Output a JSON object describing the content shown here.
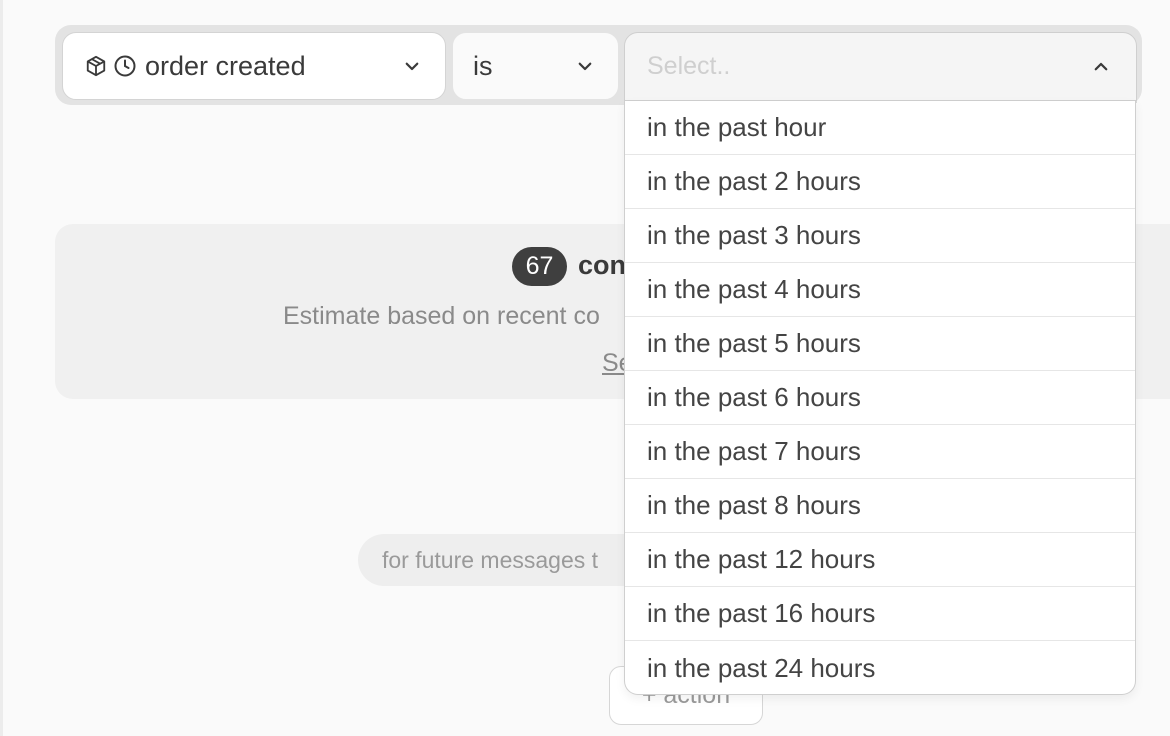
{
  "filter": {
    "field": {
      "label": "order created",
      "icons": [
        "package-icon",
        "clock-icon"
      ],
      "chevron": "chevron-down-icon"
    },
    "operator": {
      "label": "is",
      "chevron": "chevron-down-icon"
    },
    "value": {
      "placeholder": "Select..",
      "chevron": "chevron-up-icon",
      "expanded": true,
      "options": [
        "in the past hour",
        "in the past 2 hours",
        "in the past 3 hours",
        "in the past 4 hours",
        "in the past 5 hours",
        "in the past 6 hours",
        "in the past 7 hours",
        "in the past 8 hours",
        "in the past 12 hours",
        "in the past 16 hours",
        "in the past 24 hours"
      ]
    }
  },
  "estimate": {
    "count": "67",
    "label_visible": "con",
    "note_visible": "Estimate based on recent co",
    "link_visible": "Se"
  },
  "future_messages_visible": "for future messages t",
  "add_action_label": "+ action",
  "colors": {
    "background": "#fafafa",
    "badge": "#3f3f3f",
    "text": "#3a3a3a",
    "muted": "#8a8a8a"
  }
}
